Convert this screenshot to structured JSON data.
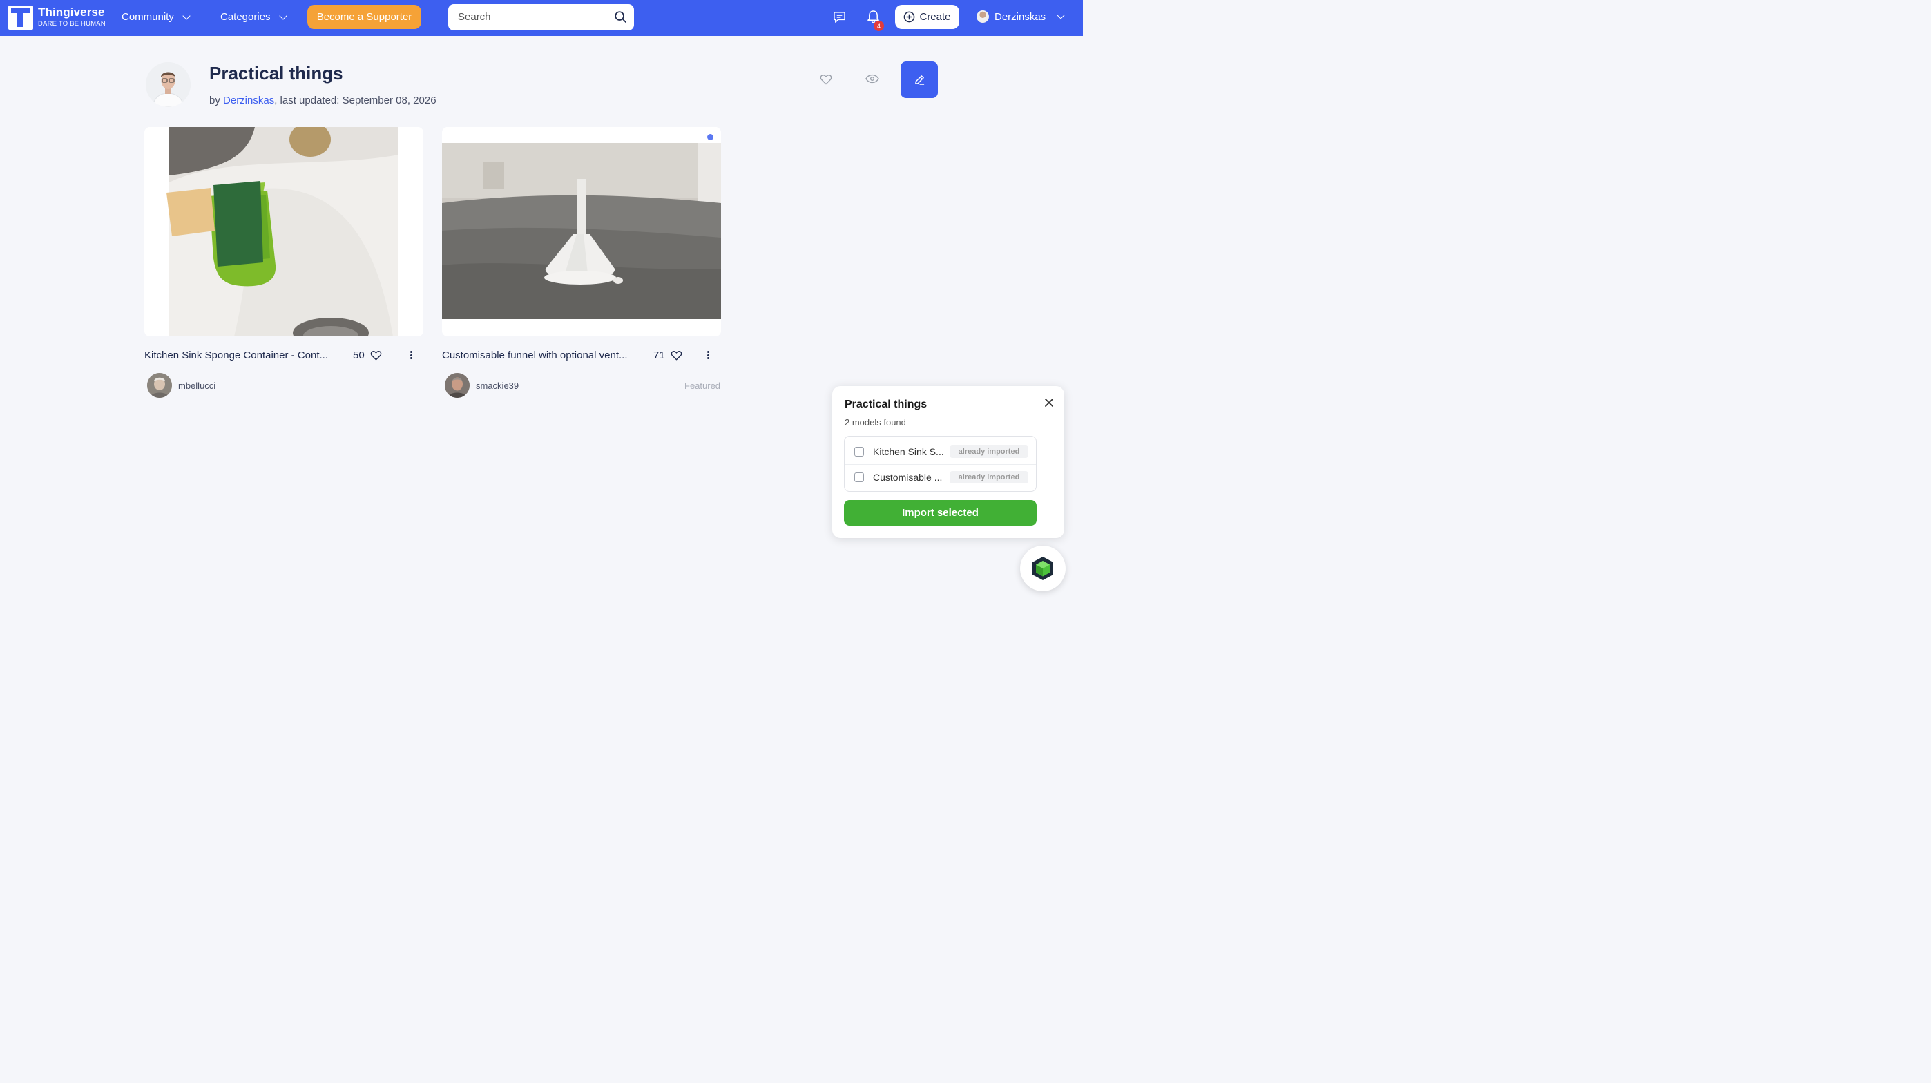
{
  "navbar": {
    "brand": "Thingiverse",
    "tagline": "DARE TO BE HUMAN",
    "community": "Community",
    "categories": "Categories",
    "supporter": "Become a Supporter",
    "search_placeholder": "Search",
    "notification_count": "4",
    "create": "Create",
    "username": "Derzinskas",
    "accent": "#3d5ff0"
  },
  "collection": {
    "title": "Practical things",
    "by_prefix": "by ",
    "author": "Derzinskas",
    "updated": ", last updated: September 08, 2026"
  },
  "things": [
    {
      "title": "Kitchen Sink Sponge Container - Cont...",
      "likes": "50",
      "creator": "mbellucci",
      "featured": ""
    },
    {
      "title": "Customisable funnel with optional vent...",
      "likes": "71",
      "creator": "smackie39",
      "featured": "Featured"
    }
  ],
  "import_popup": {
    "title": "Practical things",
    "subtitle": "2 models found",
    "items": [
      {
        "name": "Kitchen Sink S...",
        "status": "already imported"
      },
      {
        "name": "Customisable ...",
        "status": "already imported"
      }
    ],
    "button": "Import selected",
    "button_color": "#41b035"
  }
}
